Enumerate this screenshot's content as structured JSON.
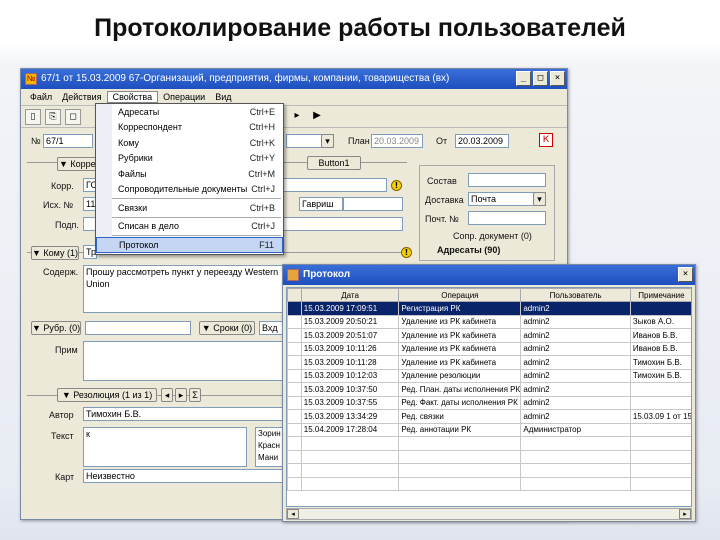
{
  "slide_title": "Протоколирование работы пользователей",
  "main_window": {
    "title": "67/1 от 15.03.2009 67-Организаций, предприятия, фирмы, компании, товарищества (вх)",
    "title_icon": "№",
    "menu": [
      "Файл",
      "Действия",
      "Свойства",
      "Операции",
      "Вид"
    ],
    "toolbar_glyphs": [
      "▯",
      "⎘",
      "◻",
      "◂",
      "▸",
      "▶"
    ]
  },
  "dropdown": {
    "items": [
      {
        "label": "Адресаты",
        "shortcut": "Ctrl+E"
      },
      {
        "label": "Корреспондент",
        "shortcut": "Ctrl+H"
      },
      {
        "label": "Кому",
        "shortcut": "Ctrl+K"
      },
      {
        "label": "Рубрики",
        "shortcut": "Ctrl+Y"
      },
      {
        "label": "Файлы",
        "shortcut": "Ctrl+M"
      },
      {
        "label": "Сопроводительные документы",
        "shortcut": "Ctrl+J"
      },
      {
        "label": "Связки",
        "shortcut": "Ctrl+B"
      },
      {
        "label": "Списан в дело",
        "shortcut": "Ctrl+J"
      },
      {
        "label": "Протокол",
        "shortcut": "F11"
      }
    ]
  },
  "form": {
    "num_label": "№",
    "num_value": "67/1",
    "plan_label": "План",
    "plan_value": "20.03.2009",
    "from_label": "От",
    "from_value": "20.03.2009",
    "k_box": "К",
    "korresp_tab": "▼ Корресп",
    "button1": "Button1",
    "org_label": "Корр.",
    "org_value": "ГС",
    "ishod_label": "Исх. №",
    "ishod_value": "11",
    "person_value": "Гавриш",
    "podp_label": "Подп.",
    "sostav_label": "Состав",
    "dostavka_label": "Доставка",
    "dostavka_value": "Почта",
    "poch_label": "Почт. №",
    "sopr_label": "Сопр. документ (0)",
    "adresaty_label": "Адресаты (90)",
    "komu_tab": "▼ Кому (1)",
    "komu_value": "Тр",
    "soder_label": "Содерж.",
    "soder_value": "Прошу рассмотреть пункт у переезду Western Union",
    "rubr_tab": "▼ Рубр. (0)",
    "sroki_tab": "▼ Сроки (0)",
    "vid_value": "Вхд",
    "prim_label": "Прим",
    "rezol_tab": "▼ Резолюция (1 из 1)",
    "sigma": "Σ",
    "avtor_label": "Автор",
    "avtor_value": "Тимохин Б.В.",
    "tekst_label": "Текст",
    "tekst_value": "к",
    "ispoln": [
      "Зорин",
      "Красн",
      "Мани"
    ],
    "kart_label": "Карт",
    "kart_value": "Неизвестно"
  },
  "protocol": {
    "title": "Протокол",
    "columns": [
      "Дата",
      "Операция",
      "Пользователь",
      "Примечание"
    ],
    "rows": [
      [
        "15.03.2009 17:09:51",
        "Регистрация РК",
        "admin2",
        ""
      ],
      [
        "15.03.2009 20:50:21",
        "Удаление из РК кабинета",
        "admin2",
        "Зыков А.О."
      ],
      [
        "15.03.2009 20:51:07",
        "Удаление из РК кабинета",
        "admin2",
        "Иванов Б.В."
      ],
      [
        "15.03.2009 10:11:26",
        "Удаление из РК кабинета",
        "admin2",
        "Иванов Б.В."
      ],
      [
        "15.03.2009 10:11:28",
        "Удаление из РК кабинета",
        "admin2",
        "Тимохин Б.В."
      ],
      [
        "15.03.2009 10:12:03",
        "Удаление резолюции",
        "admin2",
        "Тимохин Б.В."
      ],
      [
        "15.03.2009 10:37:50",
        "Ред. План. даты исполнения РК",
        "admin2",
        ""
      ],
      [
        "15.03.2009 10:37:55",
        "Ред. Факт. даты исполнения РК",
        "admin2",
        ""
      ],
      [
        "15.03.2009 13:34:29",
        "Ред. связки",
        "admin2",
        "15.03.09 1 от 15"
      ],
      [
        "15.04.2009 17:28:04",
        "Ред. аннотации РК",
        "Администратор",
        ""
      ]
    ]
  },
  "colors": {
    "titlebar": "#1d4fbf",
    "selected_row": "#0a246a",
    "menu_highlight": "#c4d6f3"
  }
}
